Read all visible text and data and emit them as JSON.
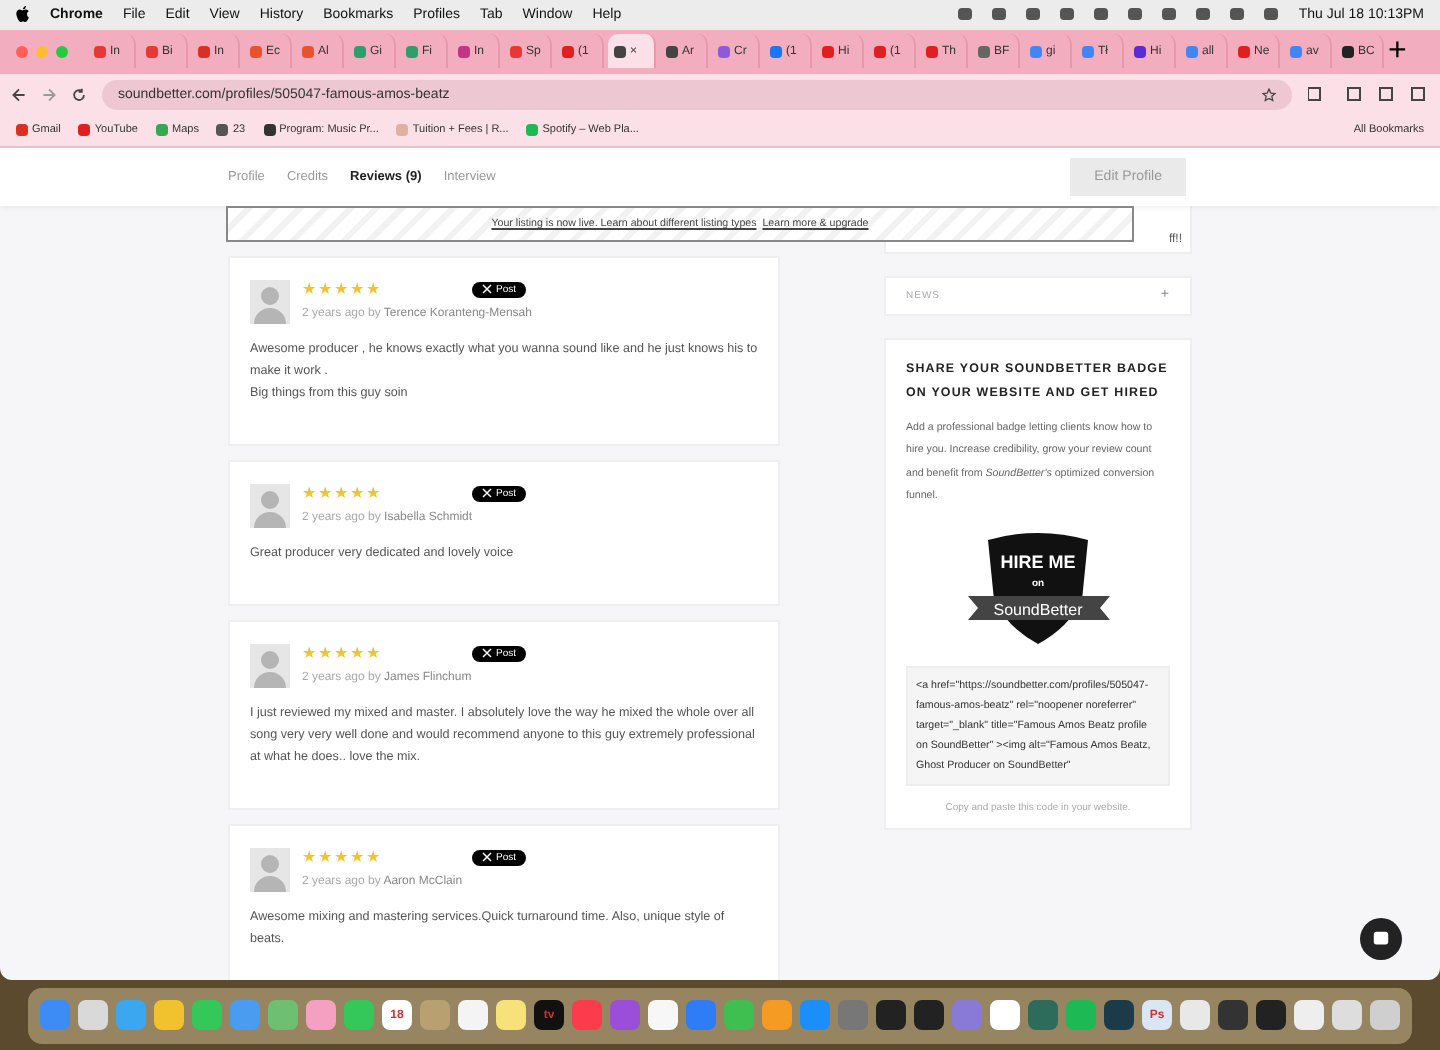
{
  "menubar": {
    "app": "Chrome",
    "menus": [
      "File",
      "Edit",
      "View",
      "History",
      "Bookmarks",
      "Profiles",
      "Tab",
      "Window",
      "Help"
    ],
    "clock": "Thu Jul 18  10:13PM"
  },
  "browser_tabs": [
    {
      "label": "In",
      "color": "#e53935",
      "selected": false
    },
    {
      "label": "Bi",
      "color": "#e53935",
      "selected": false
    },
    {
      "label": "In",
      "color": "#d93025",
      "selected": false
    },
    {
      "label": "Ec",
      "color": "#e8532f",
      "selected": false
    },
    {
      "label": "Al",
      "color": "#e8532f",
      "selected": false
    },
    {
      "label": "Gi",
      "color": "#2e9e6b",
      "selected": false
    },
    {
      "label": "Fi",
      "color": "#2e9e6b",
      "selected": false
    },
    {
      "label": "In",
      "color": "#c13584",
      "selected": false
    },
    {
      "label": "Sp",
      "color": "#e53935",
      "selected": false
    },
    {
      "label": "(1",
      "color": "#e02020",
      "selected": false
    },
    {
      "label": "×",
      "color": "#444444",
      "selected": true
    },
    {
      "label": "Ar",
      "color": "#444444",
      "selected": false
    },
    {
      "label": "Cr",
      "color": "#8e5bd8",
      "selected": false
    },
    {
      "label": "(1",
      "color": "#1877f2",
      "selected": false
    },
    {
      "label": "Hi",
      "color": "#e02020",
      "selected": false
    },
    {
      "label": "(1",
      "color": "#e02020",
      "selected": false
    },
    {
      "label": "Th",
      "color": "#e02020",
      "selected": false
    },
    {
      "label": "BF",
      "color": "#666666",
      "selected": false
    },
    {
      "label": "gi",
      "color": "#4285f4",
      "selected": false
    },
    {
      "label": "Tł",
      "color": "#4285f4",
      "selected": false
    },
    {
      "label": "Hi",
      "color": "#5b2bd6",
      "selected": false
    },
    {
      "label": "all",
      "color": "#4285f4",
      "selected": false
    },
    {
      "label": "Ne",
      "color": "#e02020",
      "selected": false
    },
    {
      "label": "av",
      "color": "#4285f4",
      "selected": false
    },
    {
      "label": "BC",
      "color": "#222222",
      "selected": false
    }
  ],
  "new_tab": "+",
  "address": "soundbetter.com/profiles/505047-famous-amos-beatz",
  "bookmarks": [
    {
      "label": "Gmail",
      "color": "#d93025"
    },
    {
      "label": "YouTube",
      "color": "#e02020"
    },
    {
      "label": "Maps",
      "color": "#34a853"
    },
    {
      "label": "23",
      "color": "#555555"
    },
    {
      "label": "Program: Music Pr...",
      "color": "#333333"
    },
    {
      "label": "Tuition + Fees | R...",
      "color": "#e0b0a0"
    },
    {
      "label": "Spotify – Web Pla...",
      "color": "#1db954"
    }
  ],
  "all_bookmarks": "All Bookmarks",
  "page_tabs": [
    {
      "label": "Profile",
      "selected": false
    },
    {
      "label": "Credits",
      "selected": false
    },
    {
      "label": "Reviews (9)",
      "selected": true
    },
    {
      "label": "Interview",
      "selected": false
    }
  ],
  "edit_button": "Edit Profile",
  "notice": {
    "text": "Your listing is now live. Learn about different listing types",
    "link": "Learn more & upgrade"
  },
  "reviews": [
    {
      "stars": 5,
      "post": "Post",
      "meta": "2 years ago by",
      "author": "Terence Koranteng-Mensah",
      "body": [
        "Awesome producer , he knows exactly what you wanna sound like and he just knows his to make it work .",
        "Big things from this guy soin"
      ]
    },
    {
      "stars": 5,
      "post": "Post",
      "meta": "2 years ago by",
      "author": "Isabella Schmidt",
      "body": [
        "Great producer very dedicated and lovely voice"
      ]
    },
    {
      "stars": 5,
      "post": "Post",
      "meta": "2 years ago by",
      "author": "James Flinchum",
      "body": [
        "I just reviewed my mixed and master. I absolutely love the way he mixed the whole over all song very very well done and would recommend anyone to this guy extremely professional at what he does.. love the mix."
      ]
    },
    {
      "stars": 5,
      "post": "Post",
      "meta": "2 years ago by",
      "author": "Aaron McClain",
      "body": [
        "Awesome mixing and mastering services.Quick turnaround time. Also, unique style of beats."
      ]
    }
  ],
  "top_card_text": "ff!!",
  "news": {
    "title": "NEWS",
    "toggle": "+"
  },
  "badge_card": {
    "title": "SHARE YOUR SOUNDBETTER BADGE ON YOUR WEBSITE AND GET HIRED",
    "description": "Add a professional badge letting clients know how to hire you. Increase credibility, grow your review count and benefit from *SoundBetter's* optimized conversion funnel.",
    "badge_top": "HIRE ME",
    "badge_on": "on",
    "badge_brand": "SoundBetter",
    "code": "<a href=\"https://soundbetter.com/profiles/505047-famous-amos-beatz\" rel=\"noopener noreferrer\" target=\"_blank\" title=\"Famous Amos Beatz profile on SoundBetter\" ><img alt=\"Famous Amos Beatz, Ghost Producer on SoundBetter\"",
    "hint": "Copy and paste this code in your website."
  },
  "dock": [
    {
      "color": "#3d8bf5"
    },
    {
      "color": "#d9d9d9"
    },
    {
      "color": "#3ba7f0"
    },
    {
      "color": "#f2c12e"
    },
    {
      "color": "#34c759"
    },
    {
      "color": "#4a9cf0"
    },
    {
      "color": "#6fbf73"
    },
    {
      "color": "#f5a0c0"
    },
    {
      "color": "#34c759"
    },
    {
      "color": "#ffffff",
      "label": "18"
    },
    {
      "color": "#b8a070"
    },
    {
      "color": "#f4f4f4"
    },
    {
      "color": "#f7e27a"
    },
    {
      "color": "#111111",
      "label": "tv"
    },
    {
      "color": "#fa3c4c"
    },
    {
      "color": "#9b4fd8"
    },
    {
      "color": "#f7f7f7"
    },
    {
      "color": "#2e7cf6"
    },
    {
      "color": "#3fbf4f"
    },
    {
      "color": "#f59a23"
    },
    {
      "color": "#1c8ef9"
    },
    {
      "color": "#777777"
    },
    {
      "color": "#222222"
    },
    {
      "color": "#222222"
    },
    {
      "color": "#8a7ad8"
    },
    {
      "color": "#ffffff"
    },
    {
      "color": "#2d6b5a"
    },
    {
      "color": "#1db954"
    },
    {
      "color": "#1b3a4a"
    },
    {
      "color": "#dbe6f5",
      "label": "Ps"
    },
    {
      "color": "#e8e8e8"
    },
    {
      "color": "#333333"
    },
    {
      "color": "#222222"
    },
    {
      "color": "#eeeeee"
    },
    {
      "color": "#dddddd"
    },
    {
      "color": "#cfcfcf"
    }
  ]
}
